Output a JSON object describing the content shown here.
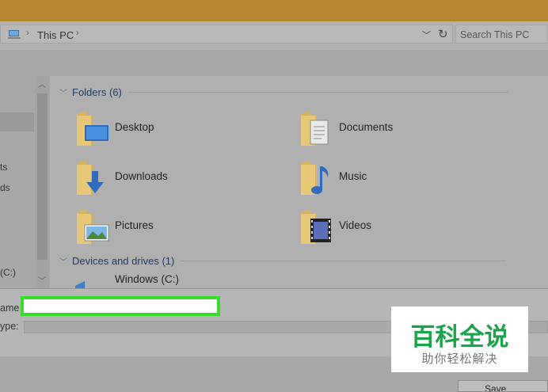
{
  "window": {
    "accent_color": "#b5862e"
  },
  "address": {
    "crumb": "This PC",
    "search_placeholder": "Search This PC"
  },
  "nav": {
    "labels": [
      "ts",
      "ds",
      "(C:)"
    ]
  },
  "groups": {
    "folders_title": "Folders (6)",
    "devices_title": "Devices and drives (1)"
  },
  "folders": [
    {
      "label": "Desktop",
      "icon": "desktop-folder-icon"
    },
    {
      "label": "Documents",
      "icon": "documents-folder-icon"
    },
    {
      "label": "Downloads",
      "icon": "downloads-folder-icon"
    },
    {
      "label": "Music",
      "icon": "music-folder-icon"
    },
    {
      "label": "Pictures",
      "icon": "pictures-folder-icon"
    },
    {
      "label": "Videos",
      "icon": "videos-folder-icon"
    }
  ],
  "drives": [
    {
      "label": "Windows (C:)",
      "icon": "drive-icon"
    }
  ],
  "form": {
    "filename_label": "ame",
    "filetype_label": "ype:",
    "filename_value": "",
    "highlight_color": "#35e02a"
  },
  "buttons": {
    "save_label": "Save"
  },
  "watermark": {
    "title": "百科全说",
    "subtitle": "助你轻松解决",
    "color": "#1aa34a"
  }
}
